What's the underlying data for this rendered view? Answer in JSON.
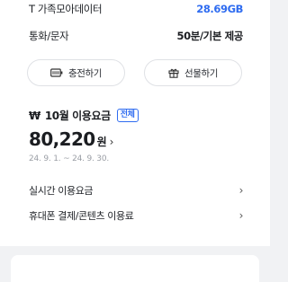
{
  "data_plan": {
    "label": "T 가족모아데이터",
    "value": "28.69GB",
    "value_color": "#2f6cf0"
  },
  "voice_plan": {
    "label": "통화/문자",
    "value": "50분/기본 제공"
  },
  "buttons": {
    "recharge": "충전하기",
    "gift": "선물하기"
  },
  "usage": {
    "currency_symbol": "₩",
    "title": "10월 이용요금",
    "badge": "전체",
    "amount": "80,220",
    "unit": "원",
    "period": "24. 9. 1. ~ 24. 9. 30."
  },
  "links": {
    "realtime": "실시간 이용요금",
    "payment": "휴대폰 결제/콘텐츠 이용료"
  },
  "icons": {
    "recharge": "battery-charge-icon",
    "gift": "gift-icon",
    "chevron": "chevron-right-icon"
  }
}
